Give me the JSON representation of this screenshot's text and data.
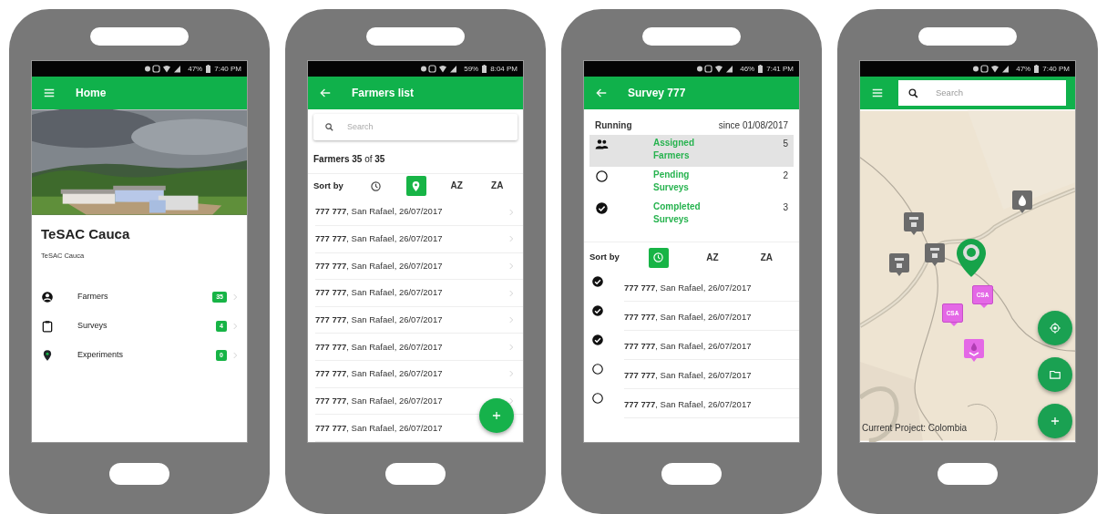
{
  "phones": [
    {
      "kind": "home",
      "status": {
        "battery": "47%",
        "time": "7:40 PM"
      },
      "app_bar": {
        "kind": "menu",
        "title": "Home"
      },
      "header": {
        "photo": {
          "kind": "picture"
        },
        "title": "TeSAC Cauca",
        "subtitle": "TeSAC Cauca"
      },
      "menu_items": [
        {
          "kind": "person",
          "label": "Farmers",
          "count": "35"
        },
        {
          "kind": "clipboard",
          "label": "Surveys",
          "count": "4"
        },
        {
          "kind": "pin",
          "label": "Experiments",
          "count": "0"
        }
      ]
    },
    {
      "kind": "list",
      "status": {
        "battery": "59%",
        "time": "8:04 PM"
      },
      "app_bar": {
        "kind": "back",
        "title": "Farmers list"
      },
      "search": {
        "placeholder": "Search"
      },
      "summary": "**Farmers 35** of **35**",
      "sort": {
        "label": "Sort by",
        "options": [
          {
            "kind": "clock",
            "selected": false
          },
          {
            "kind": "pin",
            "selected": true
          },
          {
            "kind": "text",
            "label": "AZ",
            "selected": false
          },
          {
            "kind": "text",
            "label": "ZA",
            "selected": false
          }
        ]
      },
      "rows": [
        {
          "text": "**777 777**, San Rafael, 26/07/2017",
          "chevron": true
        },
        {
          "text": "**777 777**, San Rafael, 26/07/2017",
          "chevron": true
        },
        {
          "text": "**777 777**, San Rafael, 26/07/2017",
          "chevron": true
        },
        {
          "text": "**777 777**, San Rafael, 26/07/2017",
          "chevron": true
        },
        {
          "text": "**777 777**, San Rafael, 26/07/2017",
          "chevron": true
        },
        {
          "text": "**777 777**, San Rafael, 26/07/2017",
          "chevron": true
        },
        {
          "text": "**777 777**, San Rafael, 26/07/2017",
          "chevron": true
        },
        {
          "text": "**777 777**, San Rafael, 26/07/2017",
          "chevron": true
        },
        {
          "text": "**777 777**, San Rafael, 26/07/2017",
          "chevron": false
        }
      ],
      "fabs": [
        {
          "kind": "add"
        }
      ]
    },
    {
      "kind": "survey",
      "status": {
        "battery": "46%",
        "time": "7:41 PM"
      },
      "app_bar": {
        "kind": "back",
        "title": "Survey 777"
      },
      "state": "Running",
      "since": "since 01/08/2017",
      "stats": [
        {
          "kind": "group",
          "label": "Assigned Farmers",
          "count": "5",
          "selected": true
        },
        {
          "kind": "pending",
          "label": "Pending Surveys",
          "count": "2",
          "selected": false
        },
        {
          "kind": "completed",
          "label": "Completed Surveys",
          "count": "3",
          "selected": false
        }
      ],
      "sort": {
        "label": "Sort by",
        "options": [
          {
            "kind": "clock",
            "selected": true
          },
          {
            "kind": "text",
            "label": "AZ",
            "selected": false
          },
          {
            "kind": "text",
            "label": "ZA",
            "selected": false
          }
        ]
      },
      "rows": [
        {
          "text": "**777 777**, San Rafael, 26/07/2017",
          "completed": true
        },
        {
          "text": "**777 777**, San Rafael, 26/07/2017",
          "completed": true
        },
        {
          "text": "**777 777**, San Rafael, 26/07/2017",
          "completed": true
        },
        {
          "text": "**777 777**, San Rafael, 26/07/2017",
          "completed": false
        },
        {
          "text": "**777 777**, San Rafael, 26/07/2017",
          "completed": false
        }
      ]
    },
    {
      "kind": "map",
      "status": {
        "battery": "47%",
        "time": "7:40 PM"
      },
      "app_bar": {
        "kind": "menu"
      },
      "search": {
        "placeholder": "Search"
      },
      "map": {
        "kind": "picture"
      },
      "markers": [
        {
          "kind": "facility"
        },
        {
          "kind": "facility"
        },
        {
          "kind": "facility"
        },
        {
          "kind": "water"
        },
        {
          "kind": "current"
        },
        {
          "kind": "csa",
          "label": "CSA"
        },
        {
          "kind": "csa",
          "label": "CSA"
        },
        {
          "kind": "plant"
        }
      ],
      "footer": "Current Project: Colombia",
      "fabs": [
        {
          "kind": "locate"
        },
        {
          "kind": "folder"
        },
        {
          "kind": "add"
        }
      ]
    }
  ]
}
